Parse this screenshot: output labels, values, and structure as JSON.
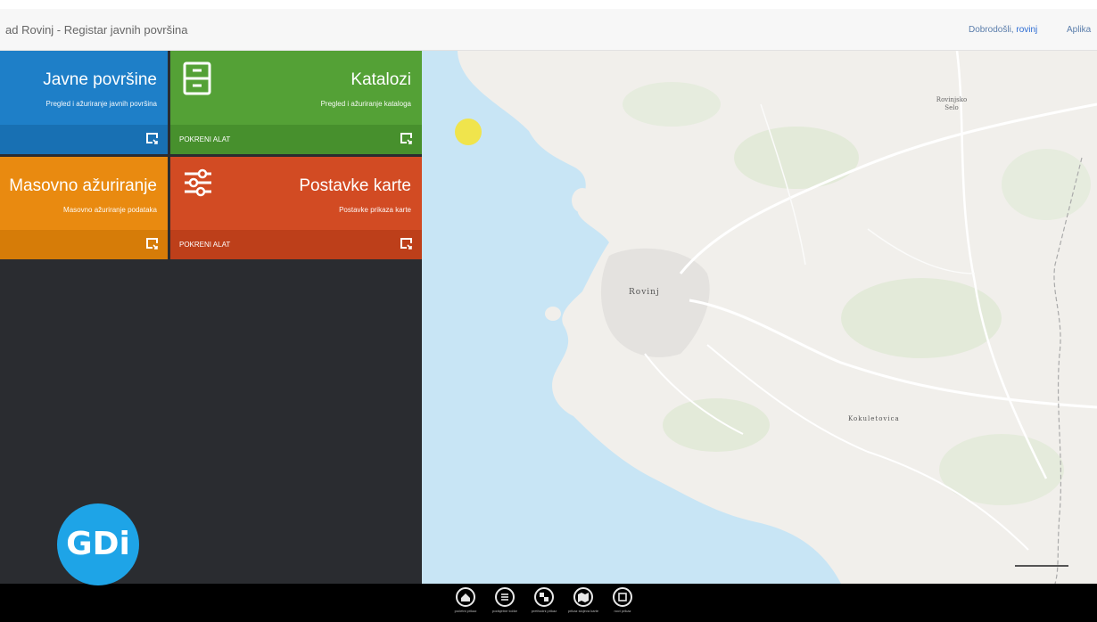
{
  "header": {
    "title": "ad Rovinj - Registar javnih površina",
    "welcome_prefix": "Dobrodošli, ",
    "welcome_user": "rovinj",
    "apps_label": "Aplika"
  },
  "tiles": [
    {
      "title": "Javne površine",
      "subtitle": "Pregled i ažuriranje javnih površina",
      "footer": "",
      "color": "#1e7fc8",
      "footer_color": "#1870b3"
    },
    {
      "title": "Katalozi",
      "subtitle": "Pregled i ažuriranje kataloga",
      "footer": "POKRENI ALAT",
      "color": "#54a136",
      "footer_color": "#47902d"
    },
    {
      "title": "Masovno ažuriranje",
      "subtitle": "Masovno ažuriranje podataka",
      "footer": "",
      "color": "#e98a10",
      "footer_color": "#d67c08"
    },
    {
      "title": "Postavke karte",
      "subtitle": "Postavke prikaza karte",
      "footer": "POKRENI ALAT",
      "color": "#d24b23",
      "footer_color": "#bd3f1a"
    }
  ],
  "map": {
    "places": {
      "rovinj": "Rovinj",
      "kokuletovica": "Kokuletovica",
      "rovinjsko_selo": "Rovinjsko Selo"
    }
  },
  "bottom_bar": {
    "items": [
      {
        "icon": "home-icon",
        "label": "početni prikaz"
      },
      {
        "icon": "list-icon",
        "label": "podsjetne točke"
      },
      {
        "icon": "zoom-icon",
        "label": "prethodni prikaz"
      },
      {
        "icon": "map-icon",
        "label": "prikaz slojeva karte"
      },
      {
        "icon": "layers-icon",
        "label": "novi prikaz"
      }
    ]
  },
  "logo": {
    "text": "GDi",
    "color": "#1ea4e7"
  }
}
